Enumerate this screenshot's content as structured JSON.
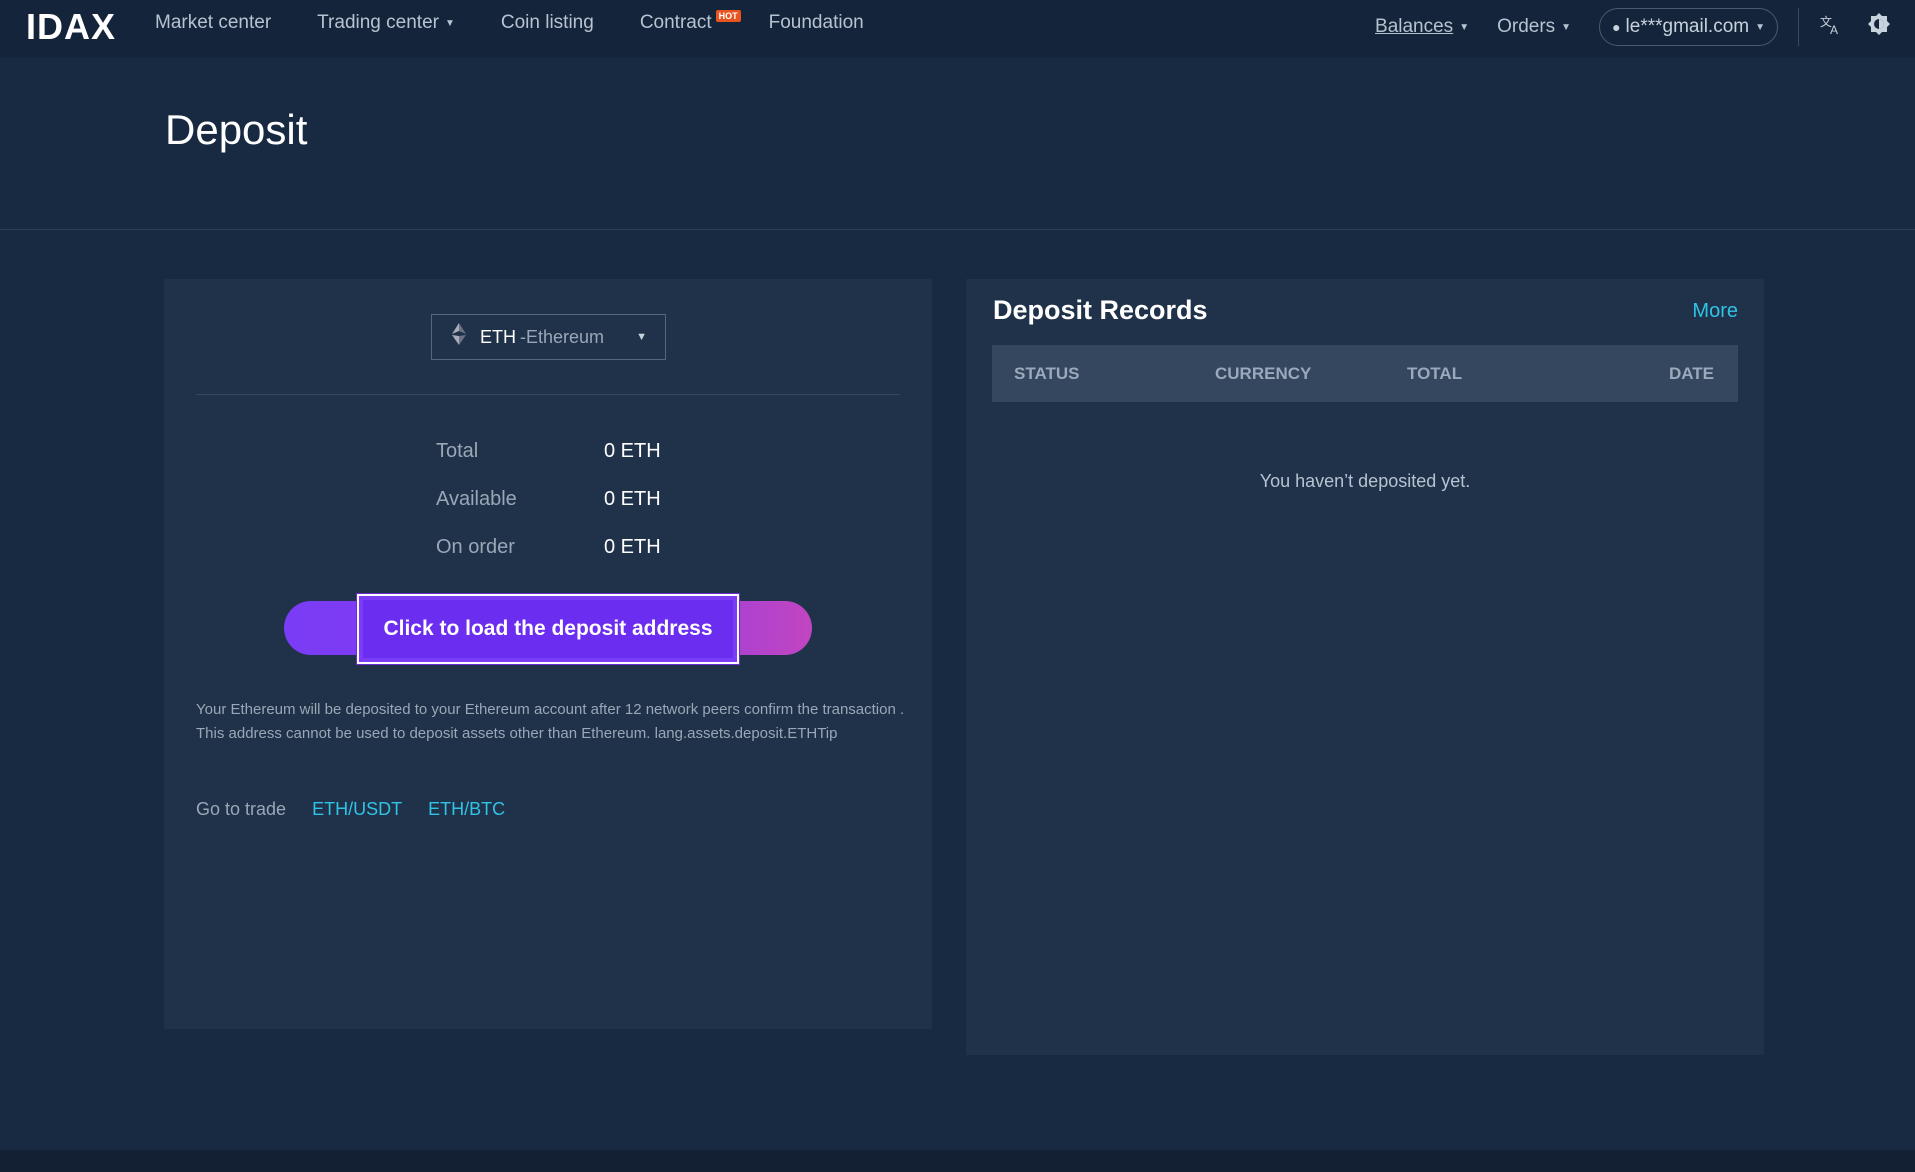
{
  "nav": {
    "logo": "IDAX",
    "links": [
      {
        "label": "Market center"
      },
      {
        "label": "Trading center"
      },
      {
        "label": "Coin listing"
      },
      {
        "label": "Contract"
      },
      {
        "label": "Foundation"
      }
    ],
    "hot_badge": "HOT",
    "balances_label": "Balances",
    "orders_label": "Orders",
    "user_email": "le***gmail.com",
    "translate_icon": "translate-icon",
    "theme_icon": "theme-toggle-icon"
  },
  "page": {
    "title": "Deposit"
  },
  "deposit": {
    "coin_code": "ETH",
    "coin_name": "-Ethereum",
    "coin_icon": "ethereum-icon",
    "balances": [
      {
        "label": "Total",
        "value": "0 ETH"
      },
      {
        "label": "Available",
        "value": "0 ETH"
      },
      {
        "label": "On order",
        "value": "0 ETH"
      }
    ],
    "load_button": "Click to load the deposit address",
    "note": "Your Ethereum will be deposited to your Ethereum account after 12 network peers confirm the transaction . This address cannot be used to deposit assets other than Ethereum. lang.assets.deposit.ETHTip",
    "go_to_trade_label": "Go to trade",
    "trade_pairs": [
      "ETH/USDT",
      "ETH/BTC"
    ]
  },
  "records": {
    "title": "Deposit Records",
    "more_label": "More",
    "columns": [
      "STATUS",
      "CURRENCY",
      "TOTAL",
      "DATE"
    ],
    "empty_message": "You haven’t deposited yet."
  },
  "colors": {
    "background": "#182a41",
    "panel": "#1f3249",
    "accent_link": "#31c3e6",
    "button_purple": "#6b2ef0",
    "hot_badge": "#e8541f"
  }
}
